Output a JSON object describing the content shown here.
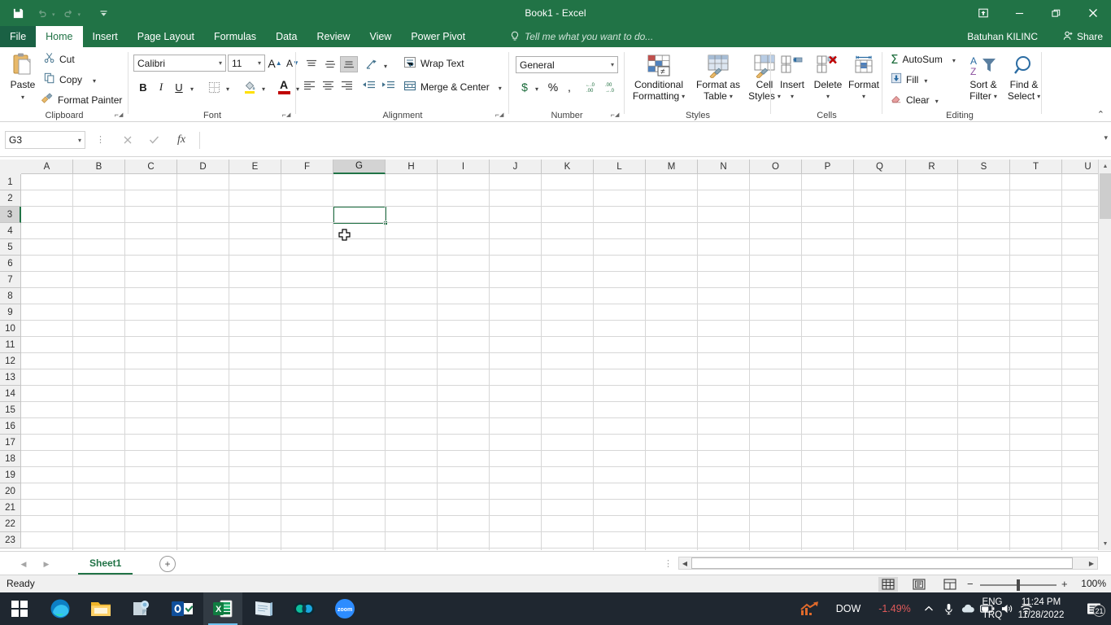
{
  "window": {
    "title": "Book1 - Excel",
    "quick_access": [
      "save-icon",
      "undo-icon",
      "redo-icon",
      "customize-qat-icon"
    ],
    "controls": {
      "ribbon_display": "ribbon-display-options-icon",
      "minimize": "minimize-icon",
      "restore": "restore-icon",
      "close": "close-icon"
    }
  },
  "tabs": [
    {
      "label": "File",
      "active": false,
      "file": true
    },
    {
      "label": "Home",
      "active": true,
      "file": false
    },
    {
      "label": "Insert",
      "active": false,
      "file": false
    },
    {
      "label": "Page Layout",
      "active": false,
      "file": false
    },
    {
      "label": "Formulas",
      "active": false,
      "file": false
    },
    {
      "label": "Data",
      "active": false,
      "file": false
    },
    {
      "label": "Review",
      "active": false,
      "file": false
    },
    {
      "label": "View",
      "active": false,
      "file": false
    },
    {
      "label": "Power Pivot",
      "active": false,
      "file": false
    }
  ],
  "tellme": {
    "placeholder": "Tell me what you want to do..."
  },
  "account": {
    "name": "Batuhan KILINC"
  },
  "share": {
    "label": "Share"
  },
  "ribbon": {
    "clipboard": {
      "group_label": "Clipboard",
      "paste": "Paste",
      "cut": "Cut",
      "copy": "Copy",
      "format_painter": "Format Painter"
    },
    "font": {
      "group_label": "Font",
      "font_name": "Calibri",
      "font_size": "11",
      "bold": "B",
      "italic": "I",
      "underline": "U",
      "grow_font": "A",
      "shrink_font": "A"
    },
    "alignment": {
      "group_label": "Alignment",
      "wrap_text": "Wrap Text",
      "merge_center": "Merge & Center"
    },
    "number": {
      "group_label": "Number",
      "format": "General",
      "currency": "$",
      "percent": "%",
      "comma": ","
    },
    "styles": {
      "group_label": "Styles",
      "conditional_formatting": "Conditional\nFormatting",
      "conditional_formatting_l1": "Conditional",
      "conditional_formatting_l2": "Formatting",
      "format_as_table_l1": "Format as",
      "format_as_table_l2": "Table",
      "cell_styles_l1": "Cell",
      "cell_styles_l2": "Styles"
    },
    "cells": {
      "group_label": "Cells",
      "insert": "Insert",
      "delete": "Delete",
      "format": "Format"
    },
    "editing": {
      "group_label": "Editing",
      "autosum": "AutoSum",
      "fill": "Fill",
      "clear": "Clear",
      "sort_filter_l1": "Sort &",
      "sort_filter_l2": "Filter",
      "find_select_l1": "Find &",
      "find_select_l2": "Select"
    }
  },
  "formula_bar": {
    "name_box": "G3",
    "formula_value": "",
    "cancel_icon": "cancel-icon",
    "enter_icon": "enter-icon",
    "function_icon": "insert-function-icon"
  },
  "grid": {
    "columns": [
      "A",
      "B",
      "C",
      "D",
      "E",
      "F",
      "G",
      "H",
      "I",
      "J",
      "K",
      "L",
      "M",
      "N",
      "O",
      "P",
      "Q",
      "R",
      "S",
      "T",
      "U"
    ],
    "rows": [
      1,
      2,
      3,
      4,
      5,
      6,
      7,
      8,
      9,
      10,
      11,
      12,
      13,
      14,
      15,
      16,
      17,
      18,
      19,
      20,
      21,
      22,
      23
    ],
    "selected_cell": "G3",
    "selected_column": "G",
    "selected_row": 3
  },
  "sheet_tabs": {
    "sheets": [
      "Sheet1"
    ],
    "active": "Sheet1",
    "add_label": "+"
  },
  "status_bar": {
    "status": "Ready",
    "views": [
      "normal-view-icon",
      "page-layout-view-icon",
      "page-break-preview-icon"
    ],
    "active_view": "normal-view-icon",
    "zoom": "100%",
    "zoom_out": "−",
    "zoom_in": "+"
  },
  "taskbar": {
    "items": [
      "start-icon",
      "edge-icon",
      "file-explorer-icon",
      "sticky-notes-icon",
      "outlook-icon",
      "excel-icon",
      "notepad-icon",
      "webex-icon",
      "zoom-icon"
    ],
    "active_item": "excel-icon",
    "tray": {
      "stock_label": "DOW",
      "stock_change": "-1.49%",
      "stock_change_color": "#e05a5a",
      "chevron": "show-hidden-icons-icon",
      "mic": "microphone-icon",
      "onedrive": "onedrive-icon",
      "battery": "battery-icon",
      "volume": "volume-icon",
      "wifi": "wifi-icon",
      "lang_line1": "ENG",
      "lang_line2": "TRQ",
      "time": "11:24 PM",
      "date": "11/28/2022",
      "notifications_count": "21"
    }
  },
  "theme": {
    "accent": "#217346",
    "titlebar_bg": "#217346",
    "taskbar_bg": "#1f2730",
    "grid_line": "#d7d7d7"
  }
}
